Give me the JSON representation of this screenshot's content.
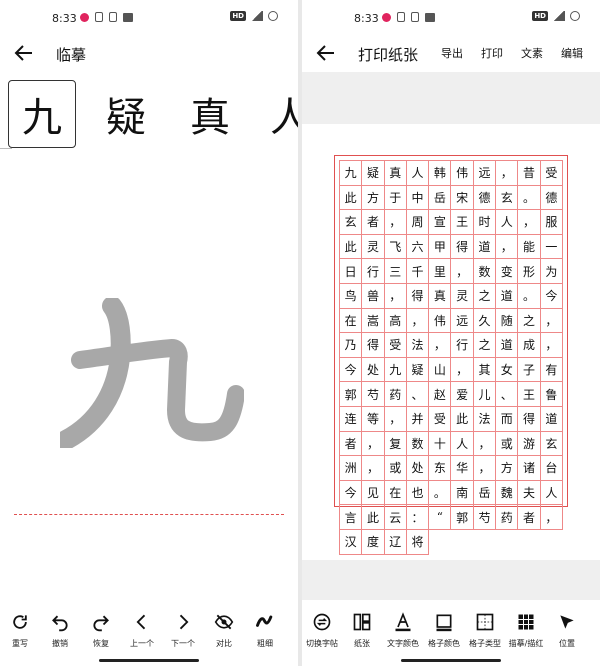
{
  "status": {
    "time": "8:33",
    "hd": "HD"
  },
  "left": {
    "title": "临摹",
    "chars": [
      "九",
      "疑",
      "真",
      "人"
    ],
    "trace_char": "九",
    "toolbar": [
      {
        "label": "重写",
        "icon": "redo-icon"
      },
      {
        "label": "撤销",
        "icon": "undo-icon"
      },
      {
        "label": "恢复",
        "icon": "restore-icon"
      },
      {
        "label": "上一个",
        "icon": "chevron-left-icon"
      },
      {
        "label": "下一个",
        "icon": "chevron-right-icon"
      },
      {
        "label": "对比",
        "icon": "eye-off-icon"
      },
      {
        "label": "粗细",
        "icon": "stroke-icon"
      }
    ]
  },
  "right": {
    "title": "打印纸张",
    "actions": [
      "导出",
      "打印",
      "文素",
      "编辑"
    ],
    "grid_text": "九疑真人韩伟远，昔受此方于中岳宋德玄。德玄者，周宣王时人，服此灵飞六甲得道，能一日行三千里，数变形为鸟兽，得真灵之道。今在嵩高，伟远久随之，乃得受法，行之道成，今处九疑山，其女子有郭芍药、赵爱儿、王鲁连等，并受此法而得道者，复数十人，或游玄洲，或处东华，方诸台今见在也。南岳魏夫人言此云：“郭芍药者，汉度辽将",
    "toolbar": [
      {
        "label": "切换字帖",
        "icon": "swap-icon"
      },
      {
        "label": "纸张",
        "icon": "paper-icon"
      },
      {
        "label": "文字颜色",
        "icon": "text-color-icon"
      },
      {
        "label": "格子颜色",
        "icon": "grid-color-icon"
      },
      {
        "label": "格子类型",
        "icon": "grid-type-icon"
      },
      {
        "label": "描摹/描红",
        "icon": "trace-icon"
      },
      {
        "label": "位置",
        "icon": "position-icon"
      }
    ]
  },
  "colors": {
    "accent": "#e05050",
    "trace": "#a8a8a8"
  }
}
